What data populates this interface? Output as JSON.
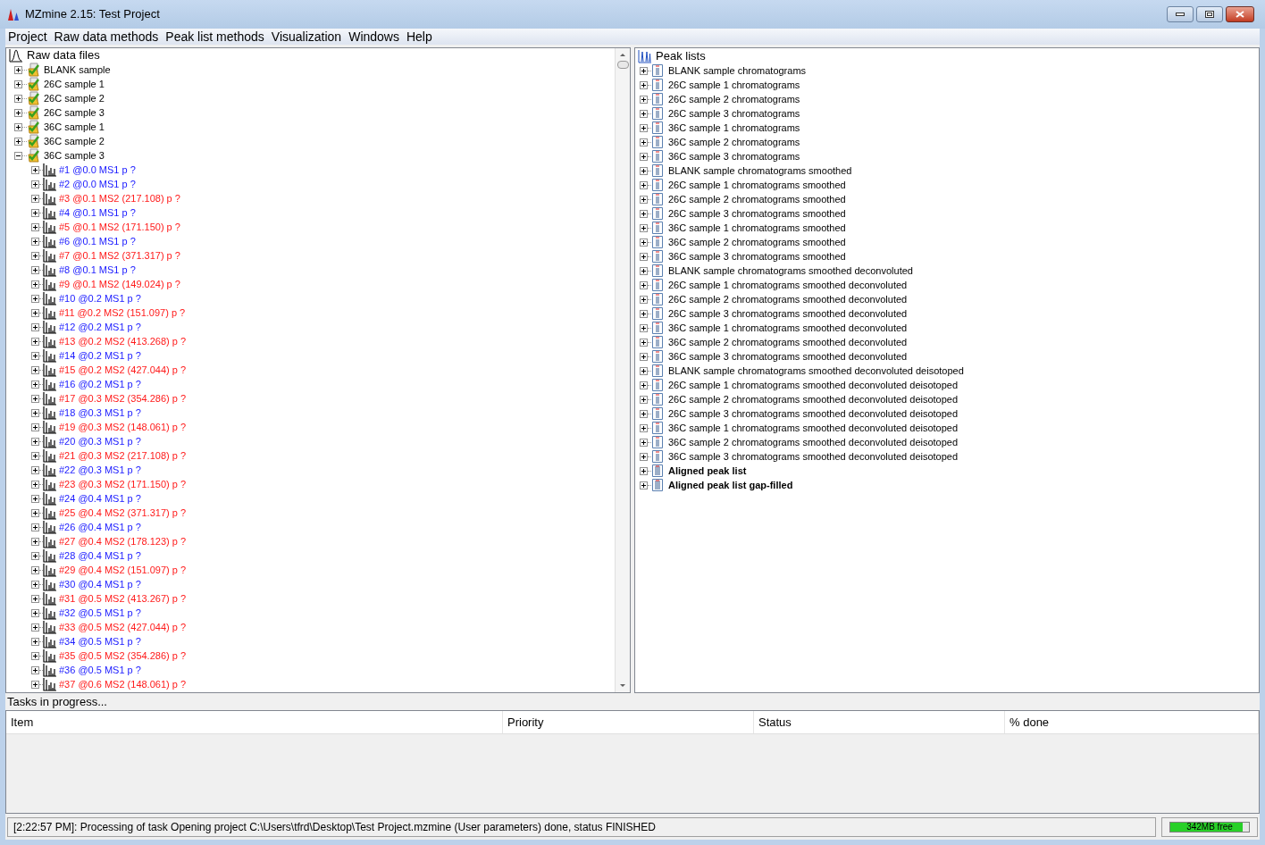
{
  "window": {
    "title": "MZmine 2.15: Test Project"
  },
  "menu": [
    "Project",
    "Raw data methods",
    "Peak list methods",
    "Visualization",
    "Windows",
    "Help"
  ],
  "raw_tree": {
    "root": "Raw data files",
    "items": [
      {
        "label": "BLANK sample",
        "expanded": false
      },
      {
        "label": "26C sample 1",
        "expanded": false
      },
      {
        "label": "26C sample 2",
        "expanded": false
      },
      {
        "label": "26C sample 3",
        "expanded": false
      },
      {
        "label": "36C sample 1",
        "expanded": false
      },
      {
        "label": "36C sample 2",
        "expanded": false
      },
      {
        "label": "36C sample 3",
        "expanded": true,
        "children": [
          {
            "label": "#1 @0.0 MS1 p ?",
            "kind": "ms1"
          },
          {
            "label": "#2 @0.0 MS1 p ?",
            "kind": "ms1"
          },
          {
            "label": "#3 @0.1 MS2 (217.108) p ?",
            "kind": "ms2"
          },
          {
            "label": "#4 @0.1 MS1 p ?",
            "kind": "ms1"
          },
          {
            "label": "#5 @0.1 MS2 (171.150) p ?",
            "kind": "ms2"
          },
          {
            "label": "#6 @0.1 MS1 p ?",
            "kind": "ms1"
          },
          {
            "label": "#7 @0.1 MS2 (371.317) p ?",
            "kind": "ms2"
          },
          {
            "label": "#8 @0.1 MS1 p ?",
            "kind": "ms1"
          },
          {
            "label": "#9 @0.1 MS2 (149.024) p ?",
            "kind": "ms2"
          },
          {
            "label": "#10 @0.2 MS1 p ?",
            "kind": "ms1"
          },
          {
            "label": "#11 @0.2 MS2 (151.097) p ?",
            "kind": "ms2"
          },
          {
            "label": "#12 @0.2 MS1 p ?",
            "kind": "ms1"
          },
          {
            "label": "#13 @0.2 MS2 (413.268) p ?",
            "kind": "ms2"
          },
          {
            "label": "#14 @0.2 MS1 p ?",
            "kind": "ms1"
          },
          {
            "label": "#15 @0.2 MS2 (427.044) p ?",
            "kind": "ms2"
          },
          {
            "label": "#16 @0.2 MS1 p ?",
            "kind": "ms1"
          },
          {
            "label": "#17 @0.3 MS2 (354.286) p ?",
            "kind": "ms2"
          },
          {
            "label": "#18 @0.3 MS1 p ?",
            "kind": "ms1"
          },
          {
            "label": "#19 @0.3 MS2 (148.061) p ?",
            "kind": "ms2"
          },
          {
            "label": "#20 @0.3 MS1 p ?",
            "kind": "ms1"
          },
          {
            "label": "#21 @0.3 MS2 (217.108) p ?",
            "kind": "ms2"
          },
          {
            "label": "#22 @0.3 MS1 p ?",
            "kind": "ms1"
          },
          {
            "label": "#23 @0.3 MS2 (171.150) p ?",
            "kind": "ms2"
          },
          {
            "label": "#24 @0.4 MS1 p ?",
            "kind": "ms1"
          },
          {
            "label": "#25 @0.4 MS2 (371.317) p ?",
            "kind": "ms2"
          },
          {
            "label": "#26 @0.4 MS1 p ?",
            "kind": "ms1"
          },
          {
            "label": "#27 @0.4 MS2 (178.123) p ?",
            "kind": "ms2"
          },
          {
            "label": "#28 @0.4 MS1 p ?",
            "kind": "ms1"
          },
          {
            "label": "#29 @0.4 MS2 (151.097) p ?",
            "kind": "ms2"
          },
          {
            "label": "#30 @0.4 MS1 p ?",
            "kind": "ms1"
          },
          {
            "label": "#31 @0.5 MS2 (413.267) p ?",
            "kind": "ms2"
          },
          {
            "label": "#32 @0.5 MS1 p ?",
            "kind": "ms1"
          },
          {
            "label": "#33 @0.5 MS2 (427.044) p ?",
            "kind": "ms2"
          },
          {
            "label": "#34 @0.5 MS1 p ?",
            "kind": "ms1"
          },
          {
            "label": "#35 @0.5 MS2 (354.286) p ?",
            "kind": "ms2"
          },
          {
            "label": "#36 @0.5 MS1 p ?",
            "kind": "ms1"
          },
          {
            "label": "#37 @0.6 MS2 (148.061) p ?",
            "kind": "ms2"
          }
        ]
      }
    ]
  },
  "peak_tree": {
    "root": "Peak lists",
    "items": [
      {
        "label": "BLANK sample chromatograms",
        "kind": "single"
      },
      {
        "label": "26C sample 1 chromatograms",
        "kind": "single"
      },
      {
        "label": "26C sample 2 chromatograms",
        "kind": "single"
      },
      {
        "label": "26C sample 3 chromatograms",
        "kind": "single"
      },
      {
        "label": "36C sample 1 chromatograms",
        "kind": "single"
      },
      {
        "label": "36C sample 2 chromatograms",
        "kind": "single"
      },
      {
        "label": "36C sample 3 chromatograms",
        "kind": "single"
      },
      {
        "label": "BLANK sample chromatograms smoothed",
        "kind": "single"
      },
      {
        "label": "26C sample 1 chromatograms smoothed",
        "kind": "single"
      },
      {
        "label": "26C sample 2 chromatograms smoothed",
        "kind": "single"
      },
      {
        "label": "26C sample 3 chromatograms smoothed",
        "kind": "single"
      },
      {
        "label": "36C sample 1 chromatograms smoothed",
        "kind": "single"
      },
      {
        "label": "36C sample 2 chromatograms smoothed",
        "kind": "single"
      },
      {
        "label": "36C sample 3 chromatograms smoothed",
        "kind": "single"
      },
      {
        "label": "BLANK sample chromatograms smoothed deconvoluted",
        "kind": "single"
      },
      {
        "label": "26C sample 1 chromatograms smoothed deconvoluted",
        "kind": "single"
      },
      {
        "label": "26C sample 2 chromatograms smoothed deconvoluted",
        "kind": "single"
      },
      {
        "label": "26C sample 3 chromatograms smoothed deconvoluted",
        "kind": "single"
      },
      {
        "label": "36C sample 1 chromatograms smoothed deconvoluted",
        "kind": "single"
      },
      {
        "label": "36C sample 2 chromatograms smoothed deconvoluted",
        "kind": "single"
      },
      {
        "label": "36C sample 3 chromatograms smoothed deconvoluted",
        "kind": "single"
      },
      {
        "label": "BLANK sample chromatograms smoothed deconvoluted deisotoped",
        "kind": "single"
      },
      {
        "label": "26C sample 1 chromatograms smoothed deconvoluted deisotoped",
        "kind": "single"
      },
      {
        "label": "26C sample 2 chromatograms smoothed deconvoluted deisotoped",
        "kind": "single"
      },
      {
        "label": "26C sample 3 chromatograms smoothed deconvoluted deisotoped",
        "kind": "single"
      },
      {
        "label": "36C sample 1 chromatograms smoothed deconvoluted deisotoped",
        "kind": "single"
      },
      {
        "label": "36C sample 2 chromatograms smoothed deconvoluted deisotoped",
        "kind": "single"
      },
      {
        "label": "36C sample 3 chromatograms smoothed deconvoluted deisotoped",
        "kind": "single"
      },
      {
        "label": "Aligned peak list",
        "kind": "aligned"
      },
      {
        "label": "Aligned peak list gap-filled",
        "kind": "aligned"
      }
    ]
  },
  "tasks": {
    "title": "Tasks in progress...",
    "columns": [
      "Item",
      "Priority",
      "Status",
      "% done"
    ]
  },
  "status_bar": {
    "message": "[2:22:57 PM]: Processing of task Opening project C:\\Users\\tfrd\\Desktop\\Test Project.mzmine (User parameters) done, status FINISHED",
    "memory": {
      "label": "342MB free",
      "level": 0.92
    }
  }
}
